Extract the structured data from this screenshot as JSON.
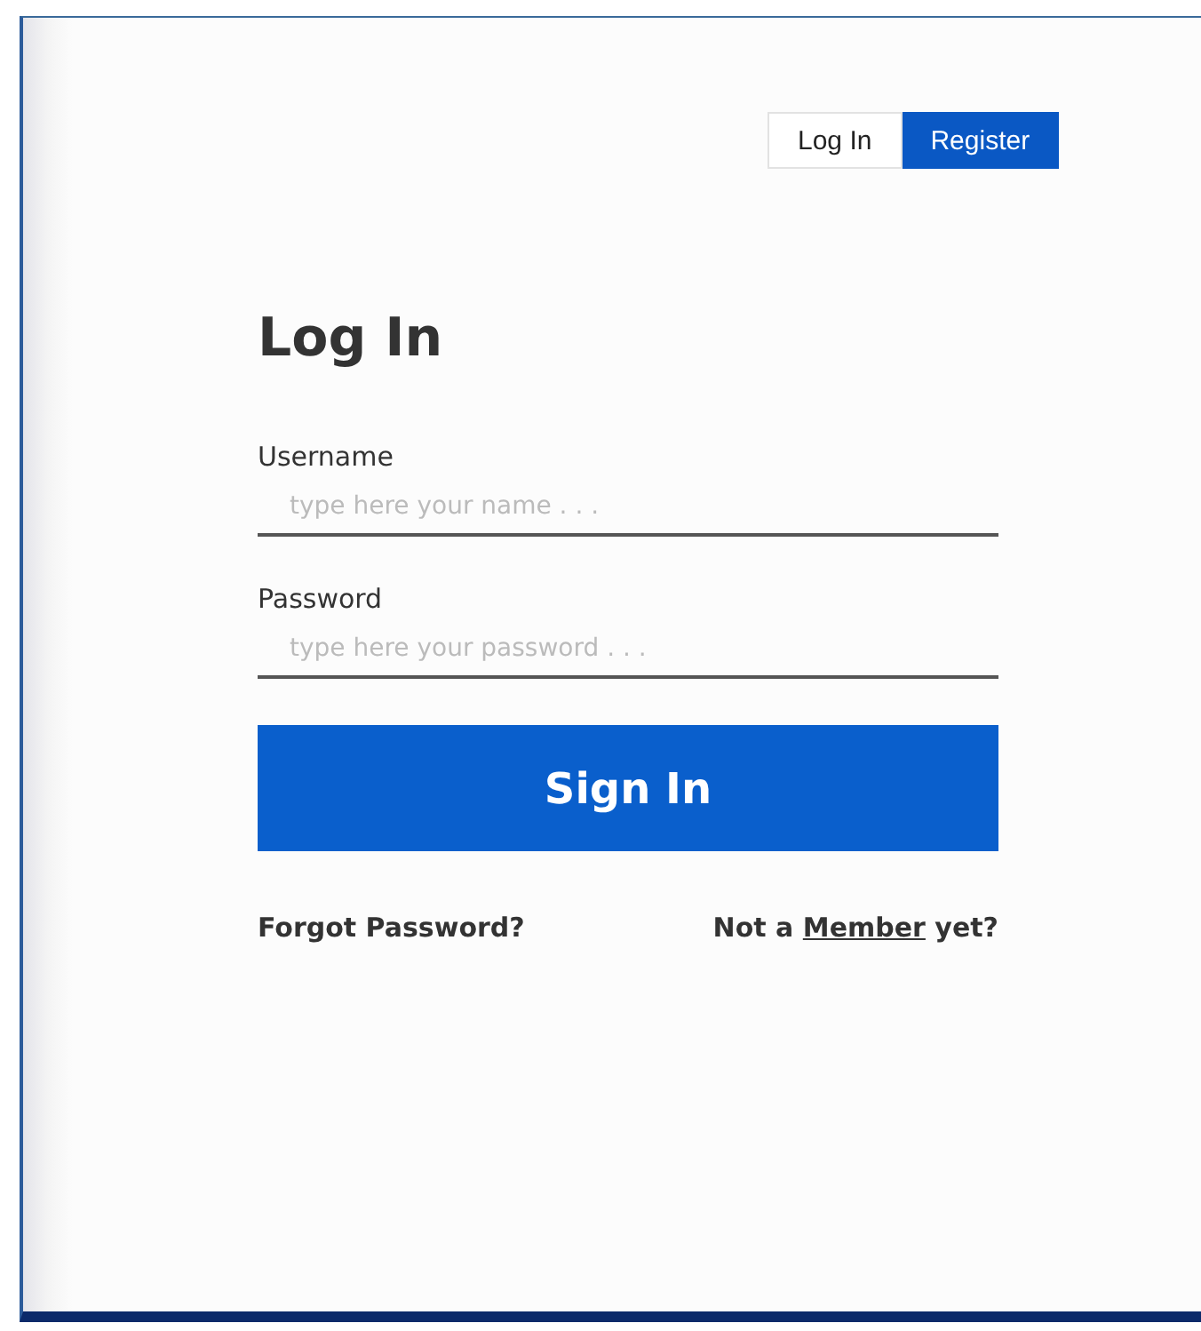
{
  "tabs": [
    {
      "label": "Log In",
      "selected": false
    },
    {
      "label": "Register",
      "selected": true
    }
  ],
  "title": "Log In",
  "fields": [
    {
      "label": "Username",
      "placeholder": "type here your name . . ."
    },
    {
      "label": "Password",
      "placeholder": "type here your password . . ."
    }
  ],
  "submit": "Sign In",
  "forgot": "Forgot Password?",
  "signup": {
    "before": "Not a ",
    "link": "Member",
    "after": " yet?"
  }
}
